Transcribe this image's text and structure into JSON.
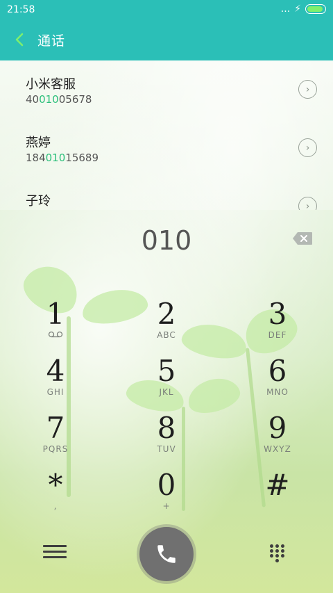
{
  "status_bar": {
    "time": "21:58",
    "signal": "...",
    "charging": "⚡"
  },
  "app_bar": {
    "title": "通话"
  },
  "contacts": [
    {
      "name": "小米客服",
      "number_prefix": "40",
      "number_match": "010",
      "number_suffix": "05678"
    },
    {
      "name": "燕婷",
      "number_prefix": "184",
      "number_match": "010",
      "number_suffix": "15689"
    },
    {
      "name": "子玲",
      "number_prefix": "",
      "number_match": "",
      "number_suffix": ""
    }
  ],
  "entry": {
    "digits": "010"
  },
  "keys": [
    {
      "digit": "1",
      "letters": ""
    },
    {
      "digit": "2",
      "letters": "ABC"
    },
    {
      "digit": "3",
      "letters": "DEF"
    },
    {
      "digit": "4",
      "letters": "GHI"
    },
    {
      "digit": "5",
      "letters": "JKL"
    },
    {
      "digit": "6",
      "letters": "MNO"
    },
    {
      "digit": "7",
      "letters": "PQRS"
    },
    {
      "digit": "8",
      "letters": "TUV"
    },
    {
      "digit": "9",
      "letters": "WXYZ"
    },
    {
      "digit": "*",
      "letters": ","
    },
    {
      "digit": "0",
      "letters": "+"
    },
    {
      "digit": "#",
      "letters": ""
    }
  ],
  "colors": {
    "accent": "#2bbfb7",
    "match": "#2bbf7a"
  }
}
